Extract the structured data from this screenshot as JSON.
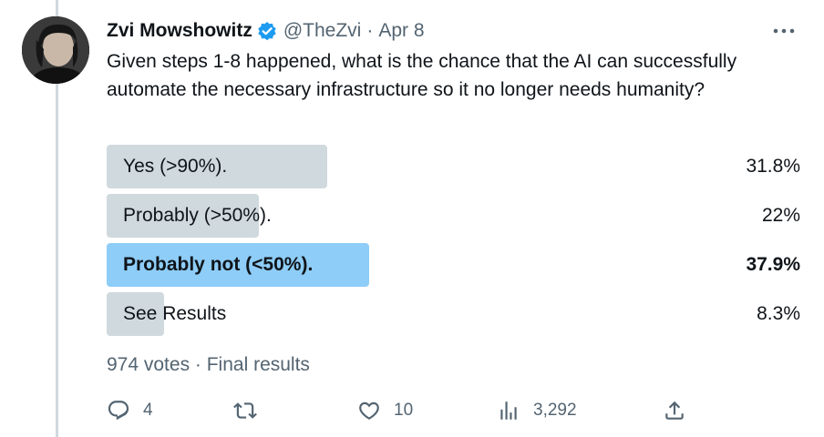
{
  "tweet": {
    "author_name": "Zvi Mowshowitz",
    "handle": "@TheZvi",
    "separator": "·",
    "date": "Apr 8",
    "text": "Given steps 1-8 happened, what is the chance that the AI can successfully automate the necessary infrastructure so it no longer needs humanity?",
    "verified_color": "#1d9bf0",
    "icons": {
      "verified": "verified-badge-icon",
      "more": "more-icon",
      "reply": "reply-icon",
      "retweet": "retweet-icon",
      "like": "like-icon",
      "views": "views-icon",
      "share": "share-icon"
    }
  },
  "poll": {
    "options": [
      {
        "label": "Yes (>90%).",
        "percent": "31.8%",
        "share": 0.318,
        "winner": false
      },
      {
        "label": "Probably (>50%).",
        "percent": "22%",
        "share": 0.22,
        "winner": false
      },
      {
        "label": "Probably not (<50%).",
        "percent": "37.9%",
        "share": 0.379,
        "winner": true
      },
      {
        "label": "See Results",
        "percent": "8.3%",
        "share": 0.083,
        "winner": false
      }
    ],
    "bar_color": "#cfd9de",
    "winner_color": "#8ecdf8",
    "meta": "974 votes · Final results"
  },
  "actions": {
    "replies": "4",
    "likes": "10",
    "views": "3,292"
  }
}
